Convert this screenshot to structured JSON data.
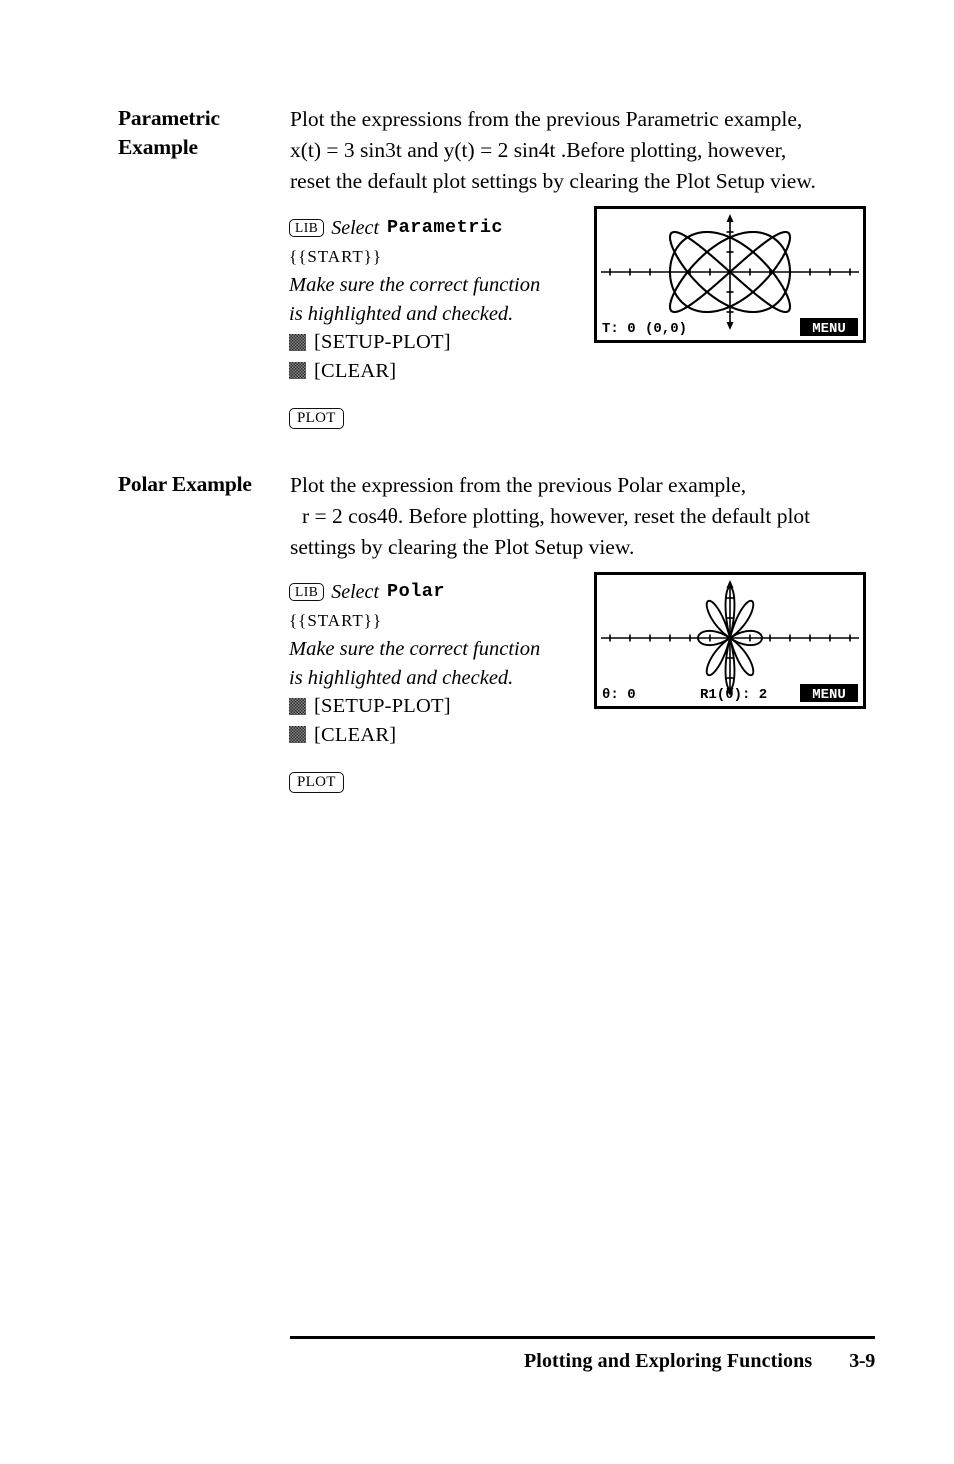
{
  "document": {
    "sections": [
      {
        "id": "parametric",
        "heading_line1": "Parametric",
        "heading_line2": "Example",
        "body": [
          "Plot the expressions from the previous Parametric example,",
          "x(t) = 3 sin3t  and  y(t) = 2 sin4t .Before plotting, however,",
          "reset the default plot settings by clearing the Plot Setup view."
        ],
        "keys": {
          "lib_key": "LIB",
          "select_word": "Select",
          "function_name": "Parametric",
          "start_line": "{{START}}",
          "note_line1": "Make sure the correct function",
          "note_line2": "is highlighted and checked.",
          "setup_plot": "[SETUP-PLOT]",
          "clear": "[CLEAR]",
          "plot_key": "PLOT"
        },
        "screen": {
          "status_left": "T: 0",
          "status_coord": "(0,0)",
          "menu_label": "MENU"
        }
      },
      {
        "id": "polar",
        "heading_line1": "Polar Example",
        "heading_line2": "",
        "body": [
          "Plot the expression from the previous Polar example,",
          "r = 2 cos4θ. Before plotting, however, reset the default plot",
          "settings by clearing the Plot Setup view."
        ],
        "keys": {
          "lib_key": "LIB",
          "select_word": "Select",
          "function_name": "Polar",
          "start_line": "{{START}}",
          "note_line1": "Make sure the correct function",
          "note_line2": "is highlighted and checked.",
          "setup_plot": "[SETUP-PLOT]",
          "clear": "[CLEAR]",
          "plot_key": "PLOT"
        },
        "screen": {
          "status_left": "θ: 0",
          "status_coord": "R1(θ): 2",
          "menu_label": "MENU"
        }
      }
    ],
    "footer": {
      "title": "Plotting and Exploring Functions",
      "page_number": "3-9"
    }
  },
  "chart_data": [
    {
      "type": "line",
      "name": "parametric-lissajous",
      "title": "",
      "equations": {
        "x": "x(t) = 3 sin3t",
        "y": "y(t) = 2 sin4t"
      },
      "parametric": {
        "x_amplitude": 3,
        "x_frequency": 3,
        "y_amplitude": 2,
        "y_frequency": 4
      },
      "t_range": [
        0,
        6.283185
      ],
      "xlim": [
        -6.5,
        6.5
      ],
      "ylim": [
        -3.2,
        3.2
      ],
      "xtick_step": 1,
      "grid": false,
      "axes": true,
      "trace_point": {
        "t": 0,
        "x": 0,
        "y": 0
      }
    },
    {
      "type": "line",
      "name": "polar-rose",
      "title": "",
      "equations": {
        "r": "r = 2 cos4θ"
      },
      "polar": {
        "amplitude": 2,
        "petal_frequency": 4,
        "petals": 8
      },
      "theta_range": [
        0,
        6.283185
      ],
      "xlim": [
        -6.5,
        6.5
      ],
      "ylim": [
        -3.2,
        3.2
      ],
      "xtick_step": 1,
      "grid": false,
      "axes": true,
      "trace_point": {
        "theta": 0,
        "r": 2
      }
    }
  ]
}
